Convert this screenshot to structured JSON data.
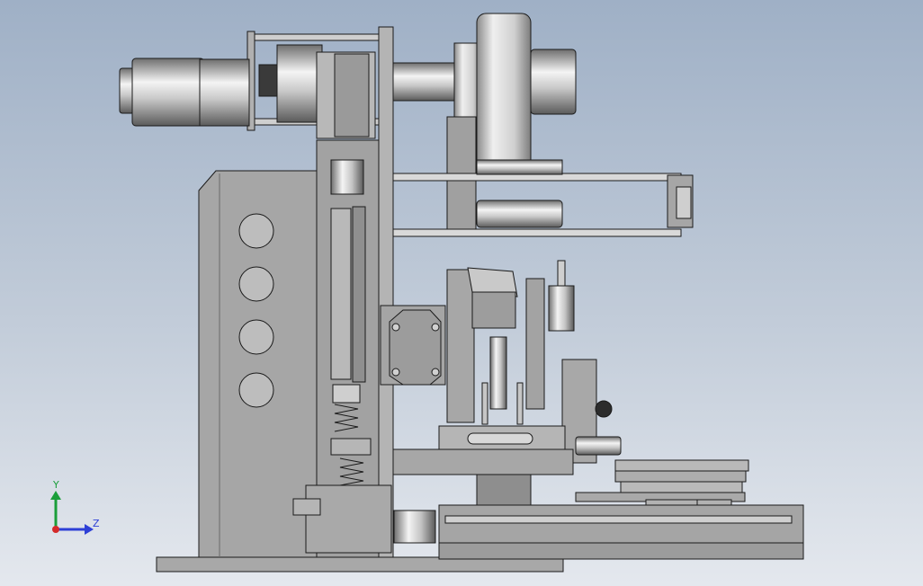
{
  "viewport": {
    "background_top": "#9fb0c6",
    "background_bottom": "#e4e8ee"
  },
  "model": {
    "body_color": "#a4a4a4",
    "shade_dark": "#7f7f7f",
    "shade_light": "#d6d6d6",
    "edge_color": "#1a1a1a",
    "motor_highlight": "#f2f2f2",
    "base_plate_holes": 4
  },
  "triad": {
    "axis_y_label": "Y",
    "axis_z_label": "Z",
    "y_color": "#1a9e3a",
    "z_color": "#2d3fd6",
    "x_color": "#d42a2a"
  }
}
